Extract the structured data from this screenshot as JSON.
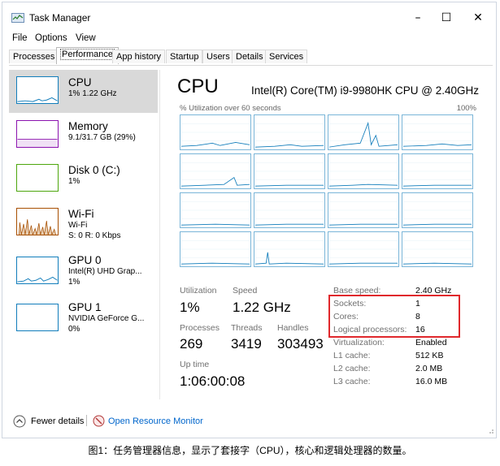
{
  "window": {
    "title": "Task Manager",
    "minimize_glyph": "–",
    "maximize_glyph": "☐",
    "close_glyph": "✕"
  },
  "menu": [
    "File",
    "Options",
    "View"
  ],
  "tabs": [
    "Processes",
    "Performance",
    "App history",
    "Startup",
    "Users",
    "Details",
    "Services"
  ],
  "active_tab": "Performance",
  "sidebar": {
    "items": [
      {
        "name": "CPU",
        "sub1": "1% 1.22 GHz",
        "sub2": "",
        "sub3": "",
        "color": "#117dbb"
      },
      {
        "name": "Memory",
        "sub1": "9.1/31.7 GB (29%)",
        "sub2": "",
        "sub3": "",
        "color": "#8b12ae"
      },
      {
        "name": "Disk 0 (C:)",
        "sub1": "1%",
        "sub2": "",
        "sub3": "",
        "color": "#4da60c"
      },
      {
        "name": "Wi-Fi",
        "sub1": "Wi-Fi",
        "sub2": "S: 0 R: 0 Kbps",
        "sub3": "",
        "color": "#a74f01"
      },
      {
        "name": "GPU 0",
        "sub1": "Intel(R) UHD Grap...",
        "sub2": "1%",
        "sub3": "",
        "color": "#117dbb"
      },
      {
        "name": "GPU 1",
        "sub1": "NVIDIA GeForce G...",
        "sub2": "0%",
        "sub3": "",
        "color": "#117dbb"
      }
    ]
  },
  "cpu": {
    "heading": "CPU",
    "model": "Intel(R) Core(TM) i9-9980HK CPU @ 2.40GHz",
    "util_label": "% Utilization over 60 seconds",
    "util_max": "100%"
  },
  "stats": {
    "utilization_label": "Utilization",
    "utilization_value": "1%",
    "speed_label": "Speed",
    "speed_value": "1.22 GHz",
    "processes_label": "Processes",
    "processes_value": "269",
    "threads_label": "Threads",
    "threads_value": "3419",
    "handles_label": "Handles",
    "handles_value": "303493",
    "uptime_label": "Up time",
    "uptime_value": "1:06:00:08"
  },
  "info": [
    {
      "label": "Base speed:",
      "value": "2.40 GHz"
    },
    {
      "label": "Sockets:",
      "value": "1"
    },
    {
      "label": "Cores:",
      "value": "8"
    },
    {
      "label": "Logical processors:",
      "value": "16"
    },
    {
      "label": "Virtualization:",
      "value": "Enabled"
    },
    {
      "label": "L1 cache:",
      "value": "512 KB"
    },
    {
      "label": "L2 cache:",
      "value": "2.0 MB"
    },
    {
      "label": "L3 cache:",
      "value": "16.0 MB"
    }
  ],
  "footer": {
    "fewer_details": "Fewer details",
    "open_monitor": "Open Resource Monitor"
  },
  "caption": "图1：任务管理器信息，显示了套接字（CPU），核心和逻辑处理器的数量。",
  "colors": {
    "accent": "#117dbb",
    "highlight": "#e0282c",
    "link": "#0066cc"
  }
}
